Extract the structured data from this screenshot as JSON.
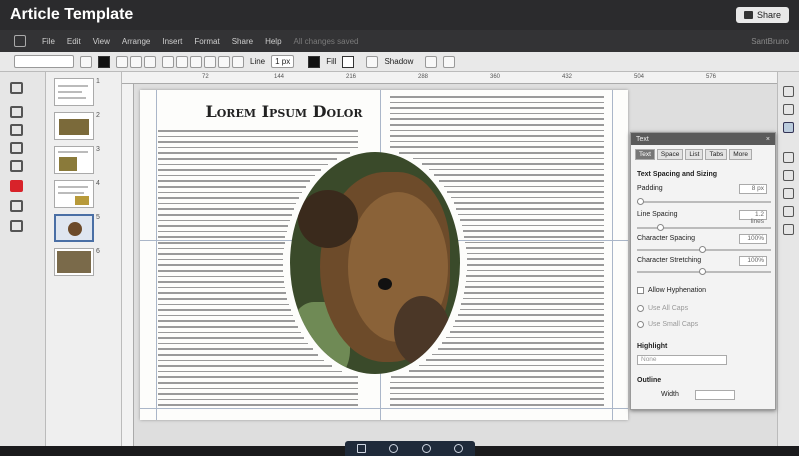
{
  "app": {
    "title": "Article Template",
    "share_label": "Share"
  },
  "menu": {
    "items": [
      "File",
      "Edit",
      "View",
      "Arrange",
      "Insert",
      "Format",
      "Share",
      "Help"
    ],
    "saved_status": "All changes saved",
    "user": "SantBruno"
  },
  "toolbar": {
    "line_label": "Line",
    "line_width": "1 px",
    "fill_label": "Fill",
    "shadow_label": "Shadow"
  },
  "ruler": {
    "marks": [
      "72",
      "144",
      "216",
      "288",
      "360",
      "432",
      "504",
      "576"
    ]
  },
  "thumbnails": {
    "numbers": [
      "1",
      "2",
      "3",
      "4",
      "5",
      "6"
    ],
    "selected": "5"
  },
  "article": {
    "headline": "Lorem Ipsum Dolor"
  },
  "text_panel": {
    "title": "Text",
    "tabs": [
      "Text",
      "Space",
      "List",
      "Tabs",
      "More"
    ],
    "section_spacing": "Text Spacing and Sizing",
    "padding_label": "Padding",
    "padding_value": "8 px",
    "line_spacing_label": "Line Spacing",
    "line_spacing_value": "1.2 lines",
    "char_spacing_label": "Character Spacing",
    "char_spacing_value": "100%",
    "char_stretch_label": "Character Stretching",
    "char_stretch_value": "100%",
    "hyphenation_label": "Allow Hyphenation",
    "all_caps_label": "Use All Caps",
    "small_caps_label": "Use Small Caps",
    "highlight_label": "Highlight",
    "highlight_value": "None",
    "outline_label": "Outline",
    "width_label": "Width"
  },
  "colors": {
    "chrome": "#2b2b2d",
    "toolbar": "#e9e9e9",
    "accent": "#4a6fa5",
    "red_icon": "#d8232a"
  }
}
